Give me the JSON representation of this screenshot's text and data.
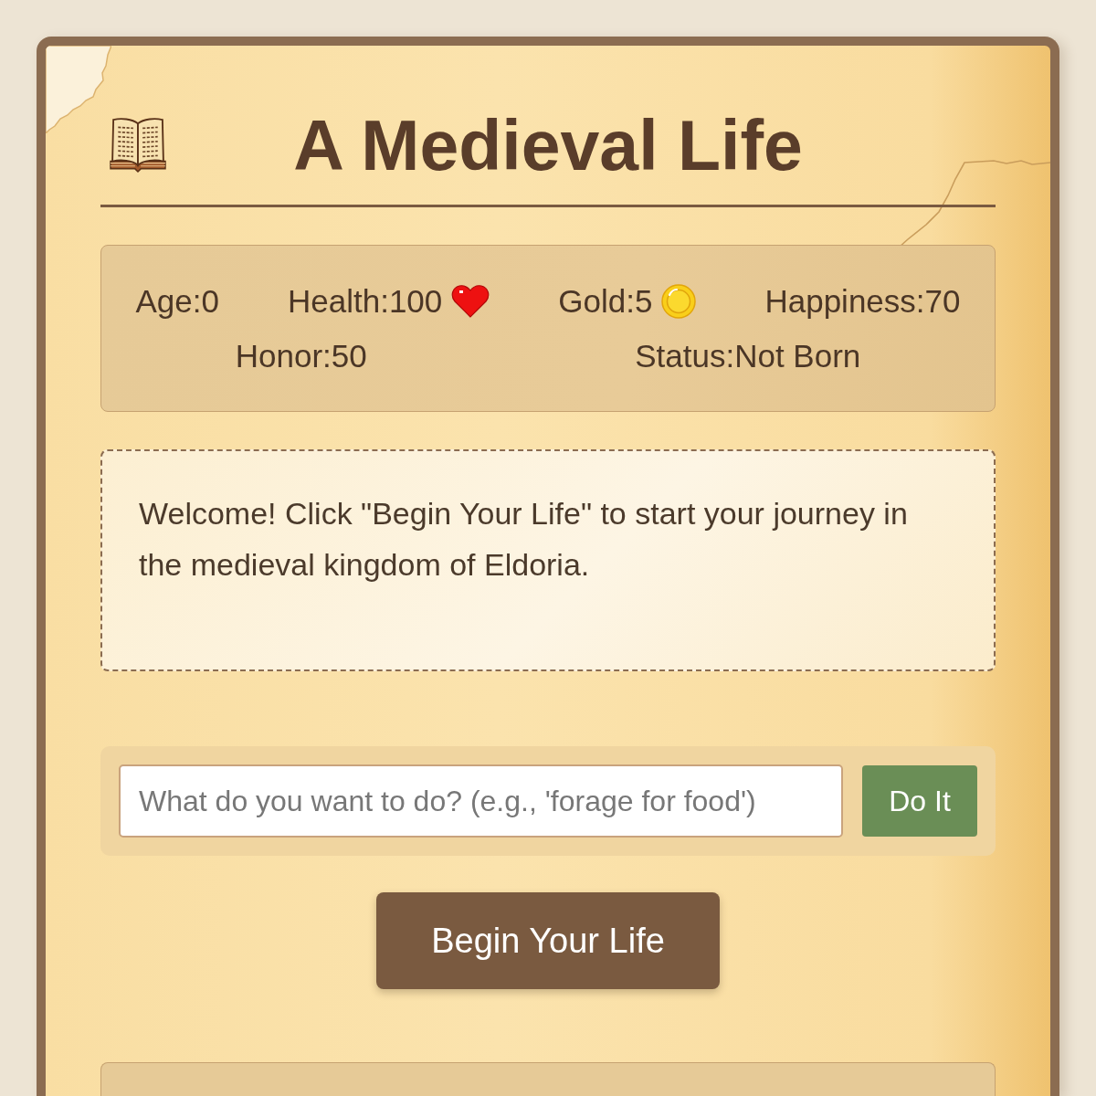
{
  "header": {
    "title": "A Medieval Life"
  },
  "stats": [
    {
      "text": "Age:0",
      "kind": "plain"
    },
    {
      "text": "Health:100",
      "kind": "heart"
    },
    {
      "text": "Gold:5",
      "kind": "coin"
    },
    {
      "text": "Happiness:70",
      "kind": "plain"
    },
    {
      "text": "Honor:50",
      "kind": "plain"
    },
    {
      "text": "Status:Not Born",
      "kind": "plain"
    }
  ],
  "message": {
    "text": "Welcome! Click \"Begin Your Life\" to start your journey in the medieval kingdom of Eldoria."
  },
  "action": {
    "placeholder": "What do you want to do? (e.g., 'forage for food')",
    "button": "Do It"
  },
  "begin_button": {
    "label": "Begin Your Life"
  }
}
